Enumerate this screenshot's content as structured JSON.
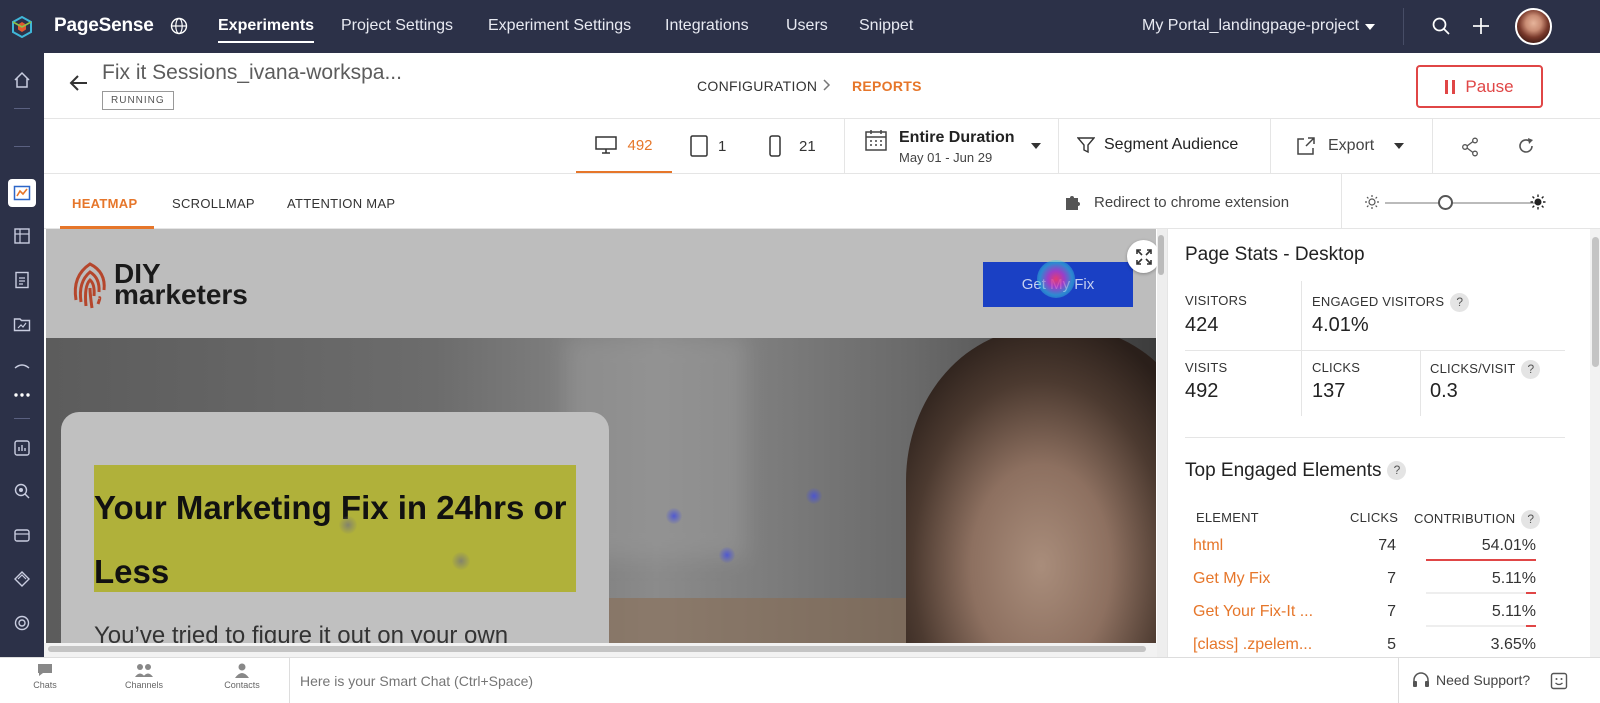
{
  "topbar": {
    "brand": "PageSense",
    "nav": [
      "Experiments",
      "Project Settings",
      "Experiment Settings",
      "Integrations",
      "Users",
      "Snippet"
    ],
    "portal": "My Portal_landingpage-project"
  },
  "header": {
    "experiment_name": "Fix it Sessions_ivana-workspa...",
    "status": "RUNNING",
    "crumb_config": "CONFIGURATION",
    "crumb_reports": "REPORTS",
    "pause_label": "Pause"
  },
  "toolbar": {
    "desktop_count": "492",
    "tablet_count": "1",
    "mobile_count": "21",
    "date_title": "Entire Duration",
    "date_range": "May 01 - Jun 29",
    "segment_label": "Segment Audience",
    "export_label": "Export"
  },
  "tabs": {
    "heatmap": "HEATMAP",
    "scrollmap": "SCROLLMAP",
    "attention": "ATTENTION MAP",
    "redirect": "Redirect to chrome extension",
    "brightness_level": 0.4
  },
  "preview": {
    "logo_line1": "DIY",
    "logo_line2": "marketers",
    "cta": "Get My Fix",
    "headline": "Your Marketing Fix in 24hrs or Less",
    "paragraph": "You’ve tried to figure it out on your own"
  },
  "stats": {
    "title": "Page Stats - Desktop",
    "visitors_label": "VISITORS",
    "visitors": "424",
    "engaged_label": "ENGAGED VISITORS",
    "engaged": "4.01%",
    "visits_label": "VISITS",
    "visits": "492",
    "clicks_label": "CLICKS",
    "clicks": "137",
    "cpv_label": "CLICKS/VISIT",
    "cpv": "0.3",
    "help": "?",
    "top_title": "Top Engaged Elements",
    "col_element": "ELEMENT",
    "col_clicks": "CLICKS",
    "col_contribution": "CONTRIBUTION",
    "rows": [
      {
        "element": "html",
        "clicks": "74",
        "contribution": "54.01%",
        "share": 0.5401
      },
      {
        "element": "Get My Fix",
        "clicks": "7",
        "contribution": "5.11%",
        "share": 0.0511
      },
      {
        "element": "Get Your Fix-It ...",
        "clicks": "7",
        "contribution": "5.11%",
        "share": 0.0511
      },
      {
        "element": "[class] .zpelem...",
        "clicks": "5",
        "contribution": "3.65%",
        "share": 0.0365
      }
    ]
  },
  "bottombar": {
    "chats": "Chats",
    "channels": "Channels",
    "contacts": "Contacts",
    "chat_placeholder": "Here is your Smart Chat (Ctrl+Space)",
    "support": "Need Support?"
  },
  "colors": {
    "topbar": "#2c3148",
    "accent": "#e6762a",
    "danger": "#e04646",
    "cta_blue": "#1a40c4"
  }
}
